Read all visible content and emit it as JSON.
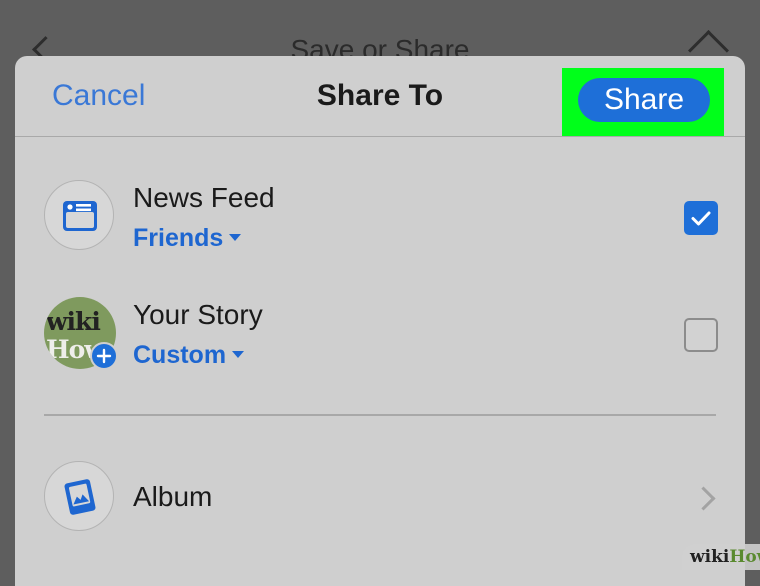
{
  "background": {
    "title": "Save or Share"
  },
  "sheet": {
    "cancel_label": "Cancel",
    "title": "Share To",
    "share_label": "Share"
  },
  "rows": [
    {
      "title": "News Feed",
      "subtitle": "Friends",
      "checked": true,
      "icon": "news-feed-icon"
    },
    {
      "title": "Your Story",
      "subtitle": "Custom",
      "checked": false,
      "icon": "story-avatar"
    },
    {
      "title": "Album",
      "icon": "album-icon"
    }
  ],
  "avatar_text": [
    "wiki",
    "How"
  ],
  "watermark": {
    "part1": "wiki",
    "part2": "How"
  },
  "colors": {
    "accent_blue": "#1e6fd8",
    "highlight_green": "#00ff1a",
    "sheet_bg": "#cfcfcf"
  }
}
